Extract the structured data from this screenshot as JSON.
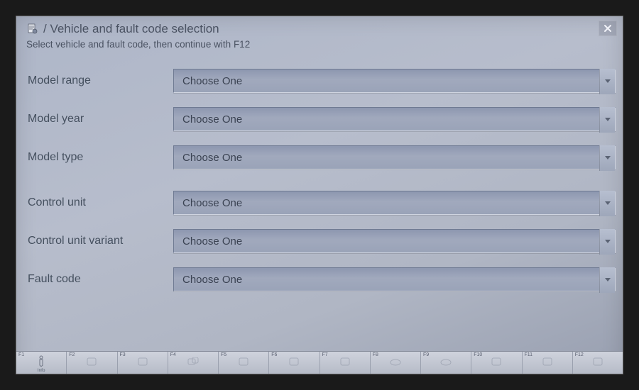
{
  "title": "/ Vehicle and fault code selection",
  "subtitle": "Select vehicle and fault code, then continue with F12",
  "placeholder": "Choose One",
  "fields": [
    {
      "label": "Model range"
    },
    {
      "label": "Model year"
    },
    {
      "label": "Model type"
    },
    {
      "label": "Control unit"
    },
    {
      "label": "Control unit variant"
    },
    {
      "label": "Fault code"
    }
  ],
  "fkeys": [
    {
      "num": "F1",
      "caption": "Info",
      "active": true
    },
    {
      "num": "F2"
    },
    {
      "num": "F3"
    },
    {
      "num": "F4"
    },
    {
      "num": "F5"
    },
    {
      "num": "F6"
    },
    {
      "num": "F7"
    },
    {
      "num": "F8"
    },
    {
      "num": "F9"
    },
    {
      "num": "F10"
    },
    {
      "num": "F11"
    },
    {
      "num": "F12"
    }
  ]
}
